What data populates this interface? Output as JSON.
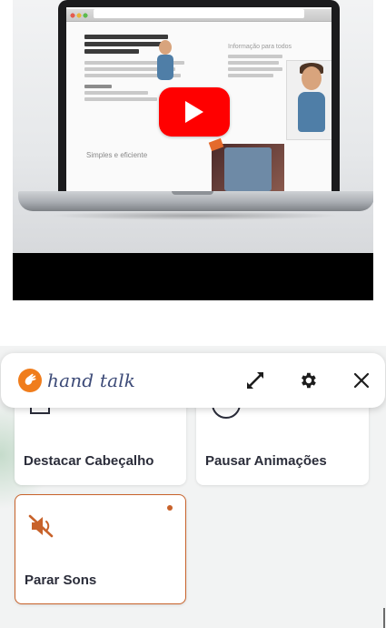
{
  "video": {
    "screen_heading_right": "Informação para todos",
    "screen_subheading": "Simples e eficiente"
  },
  "widget": {
    "brand": "hand talk",
    "accent_color": "#f07d1c",
    "active_border_color": "#c8622a",
    "toolbar": {
      "expand_icon": "expand-icon",
      "settings_icon": "gear-icon",
      "close_icon": "close-icon"
    },
    "options": [
      {
        "label": "Destacar Cabeçalho",
        "active": false
      },
      {
        "label": "Pausar Animações",
        "active": false
      },
      {
        "label": "Parar Sons",
        "active": true,
        "icon": "mute-icon"
      }
    ]
  }
}
